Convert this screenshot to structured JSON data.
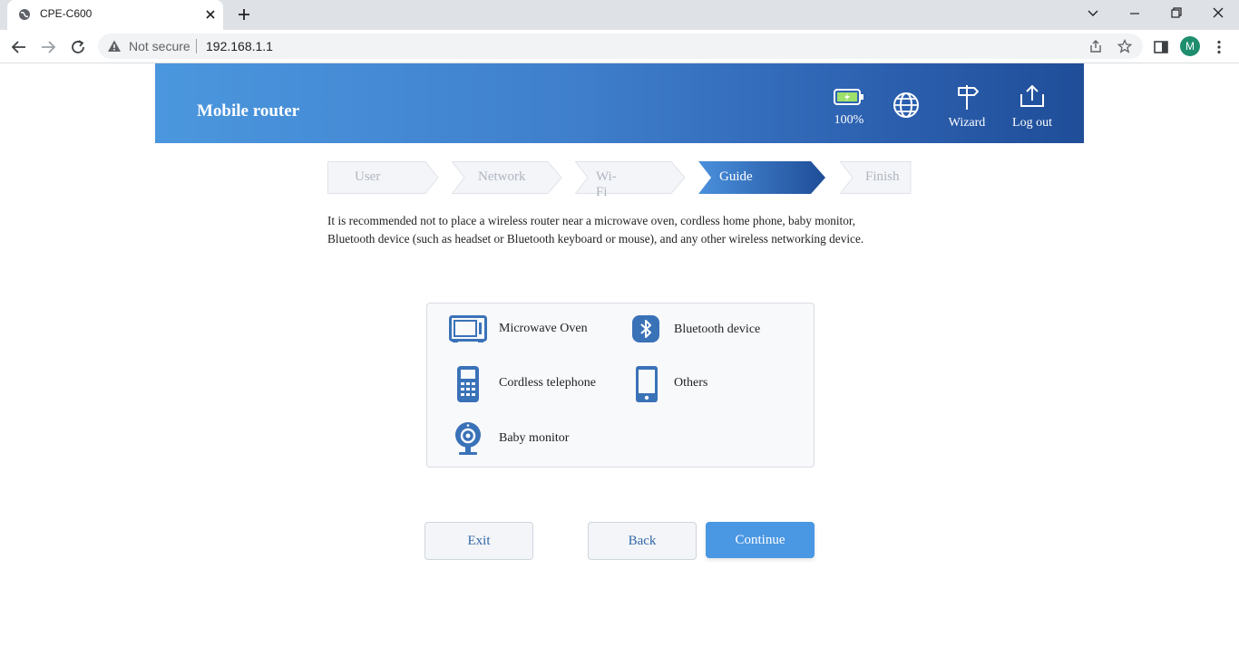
{
  "browser": {
    "tab_title": "CPE-C600",
    "security_label": "Not secure",
    "url": "192.168.1.1",
    "profile_initial": "M"
  },
  "header": {
    "brand": "Mobile router",
    "battery_percent": "100%",
    "wizard_label": "Wizard",
    "logout_label": "Log out"
  },
  "steps": [
    {
      "label": "User",
      "state": "inactive"
    },
    {
      "label": "Network",
      "state": "inactive"
    },
    {
      "label": "Wi-Fi",
      "state": "inactive"
    },
    {
      "label": "Guide",
      "state": "active"
    },
    {
      "label": "Finish",
      "state": "inactive"
    }
  ],
  "guide": {
    "intro_line1": "It is recommended not to place a wireless router near a microwave oven, cordless home phone, baby monitor,",
    "intro_line2": "Bluetooth device (such as headset or Bluetooth keyboard or mouse), and any other wireless networking device.",
    "devices": [
      {
        "label": "Microwave Oven",
        "icon": "microwave-icon"
      },
      {
        "label": "Bluetooth device",
        "icon": "bluetooth-icon"
      },
      {
        "label": "Cordless telephone",
        "icon": "cordless-phone-icon"
      },
      {
        "label": "Others",
        "icon": "smartphone-icon"
      },
      {
        "label": "Baby monitor",
        "icon": "webcam-icon"
      }
    ]
  },
  "buttons": {
    "exit": "Exit",
    "back": "Back",
    "continue": "Continue"
  },
  "colors": {
    "accent": "#4a97e3",
    "header_start": "#4b97de",
    "header_end": "#1f4d98",
    "icon_blue": "#3a72b8"
  }
}
